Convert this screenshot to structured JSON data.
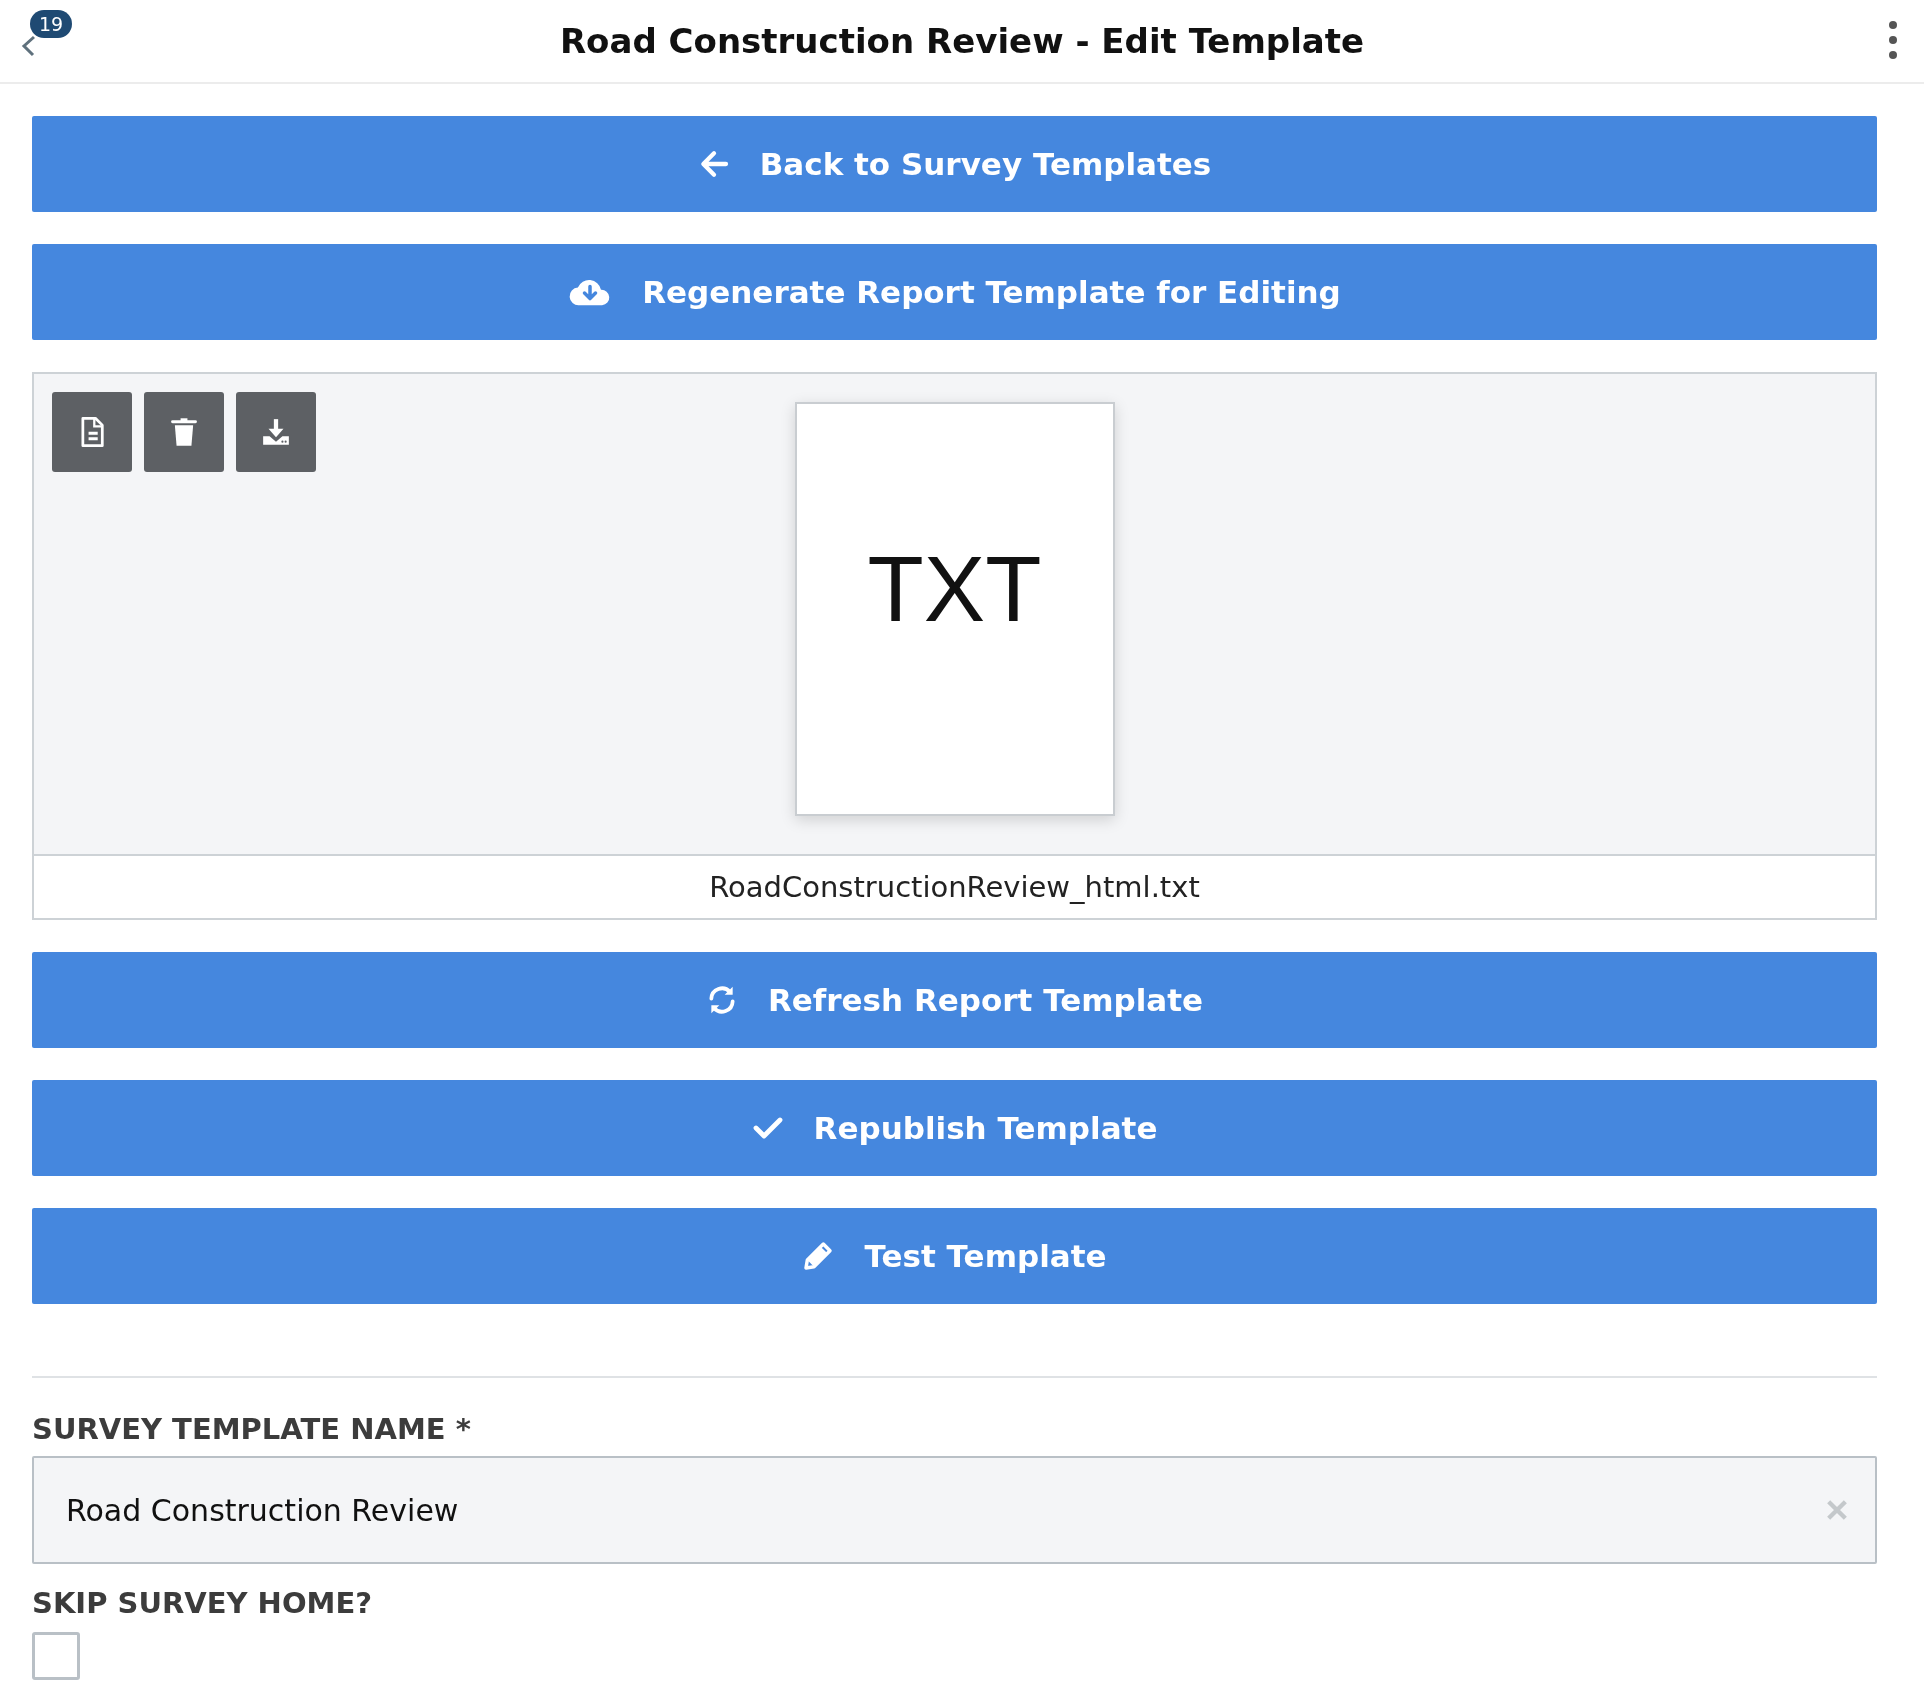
{
  "header": {
    "title": "Road Construction Review - Edit Template",
    "badge": "19"
  },
  "top_buttons": [
    {
      "label": "Back to Survey Templates",
      "kind": "back"
    },
    {
      "label": "Regenerate Report Template for Editing",
      "kind": "cloud"
    }
  ],
  "preview": {
    "tools": [
      {
        "kind": "file"
      },
      {
        "kind": "trash"
      },
      {
        "kind": "download"
      }
    ],
    "file_type": "TXT",
    "file_name": "RoadConstructionReview_html.txt"
  },
  "bottom_buttons": [
    {
      "label": "Refresh Report Template",
      "kind": "refresh"
    },
    {
      "label": "Republish Template",
      "kind": "check"
    },
    {
      "label": "Test Template",
      "kind": "pencil"
    }
  ],
  "form": {
    "name_label": "SURVEY TEMPLATE NAME *",
    "name_value": "Road Construction Review",
    "skip_label": "SKIP SURVEY HOME?",
    "skip_checked": false
  }
}
